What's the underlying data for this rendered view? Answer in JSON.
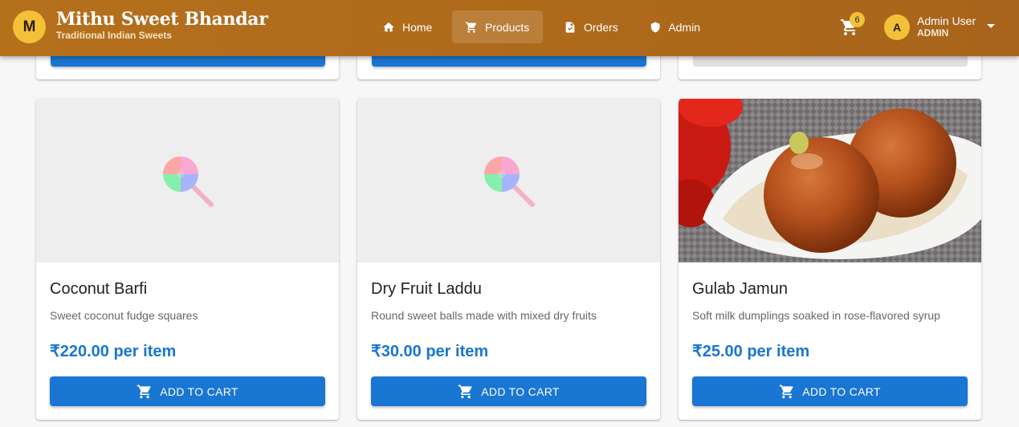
{
  "brand": {
    "initial": "M",
    "name": "Mithu Sweet Bhandar",
    "tagline": "Traditional Indian Sweets"
  },
  "nav": [
    {
      "label": "Home",
      "icon": "home-icon"
    },
    {
      "label": "Products",
      "icon": "cart-icon",
      "active": true
    },
    {
      "label": "Orders",
      "icon": "receipt-icon"
    },
    {
      "label": "Admin",
      "icon": "shield-icon"
    }
  ],
  "cart": {
    "count": "6"
  },
  "user": {
    "initial": "A",
    "name": "Admin User",
    "role": "ADMIN"
  },
  "products": [
    {
      "name": "Coconut Barfi",
      "description": "Sweet coconut fudge squares",
      "price": "₹220.00 per item",
      "image": "lollipop-placeholder",
      "button": "ADD TO CART"
    },
    {
      "name": "Dry Fruit Laddu",
      "description": "Round sweet balls made with mixed dry fruits",
      "price": "₹30.00 per item",
      "image": "lollipop-placeholder",
      "button": "ADD TO CART"
    },
    {
      "name": "Gulab Jamun",
      "description": "Soft milk dumplings soaked in rose-flavored syrup",
      "price": "₹25.00 per item",
      "image": "gulab-jamun-photo",
      "button": "ADD TO CART"
    }
  ],
  "colors": {
    "header": "#b06b1b",
    "accent": "#1976d2",
    "gold": "#f3c138"
  }
}
